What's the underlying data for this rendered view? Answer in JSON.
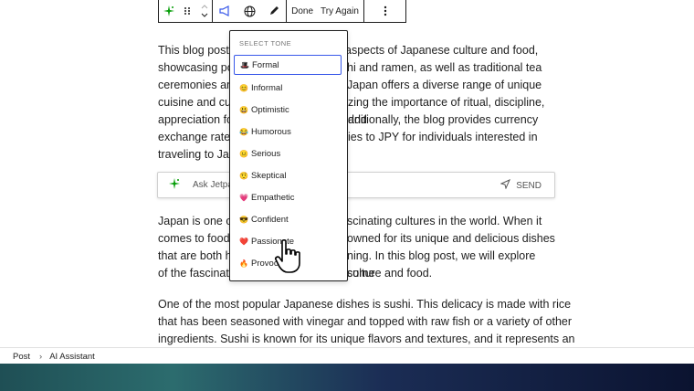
{
  "toolbar": {
    "done_label": "Done",
    "try_again_label": "Try Again"
  },
  "paragraphs": {
    "p1": [
      "This blog post",
      "aspects of Japanese culture and food,",
      "showcasing po",
      "hi and ramen, as well as traditional tea",
      "ceremonies an",
      "Japan offers a diverse range of unique",
      "cuisine and cul",
      "zing the importance of ritual, discipline, and",
      "appreciation fo",
      "dditionally, the blog provides currency",
      "exchange rates",
      "ies to JPY for individuals interested in",
      "traveling to Jap"
    ],
    "p2": [
      "Japan is one of",
      "scinating cultures in the world. When it",
      "comes to food,",
      "owned for its unique and delicious dishes",
      "that are both h",
      "ning. In this blog post, we will explore some",
      "of the fascinati",
      "culture and food."
    ],
    "p3": [
      "One of the most popular Japanese dishes is sushi. This delicacy is made with rice",
      "that has been seasoned with vinegar and topped with raw fish or a variety of other",
      "ingredients. Sushi is known for its unique flavors and textures, and it represents an"
    ]
  },
  "ask_bar": {
    "text": "Ask Jetpac",
    "send_label": "SEND"
  },
  "tone_menu": {
    "header": "SELECT TONE",
    "items": [
      {
        "emoji": "🎩",
        "label": "Formal",
        "selected": true
      },
      {
        "emoji": "😊",
        "label": "Informal"
      },
      {
        "emoji": "😃",
        "label": "Optimistic"
      },
      {
        "emoji": "😂",
        "label": "Humorous"
      },
      {
        "emoji": "😐",
        "label": "Serious"
      },
      {
        "emoji": "🤨",
        "label": "Skeptical"
      },
      {
        "emoji": "💗",
        "label": "Empathetic"
      },
      {
        "emoji": "😎",
        "label": "Confident"
      },
      {
        "emoji": "❤️",
        "label": "Passionate"
      },
      {
        "emoji": "🔥",
        "label": "Provoca"
      }
    ]
  },
  "breadcrumb": {
    "root": "Post",
    "separator": "›",
    "current": "AI Assistant"
  },
  "colors": {
    "accent": "#3858e9",
    "jetpack_green": "#069e08"
  }
}
